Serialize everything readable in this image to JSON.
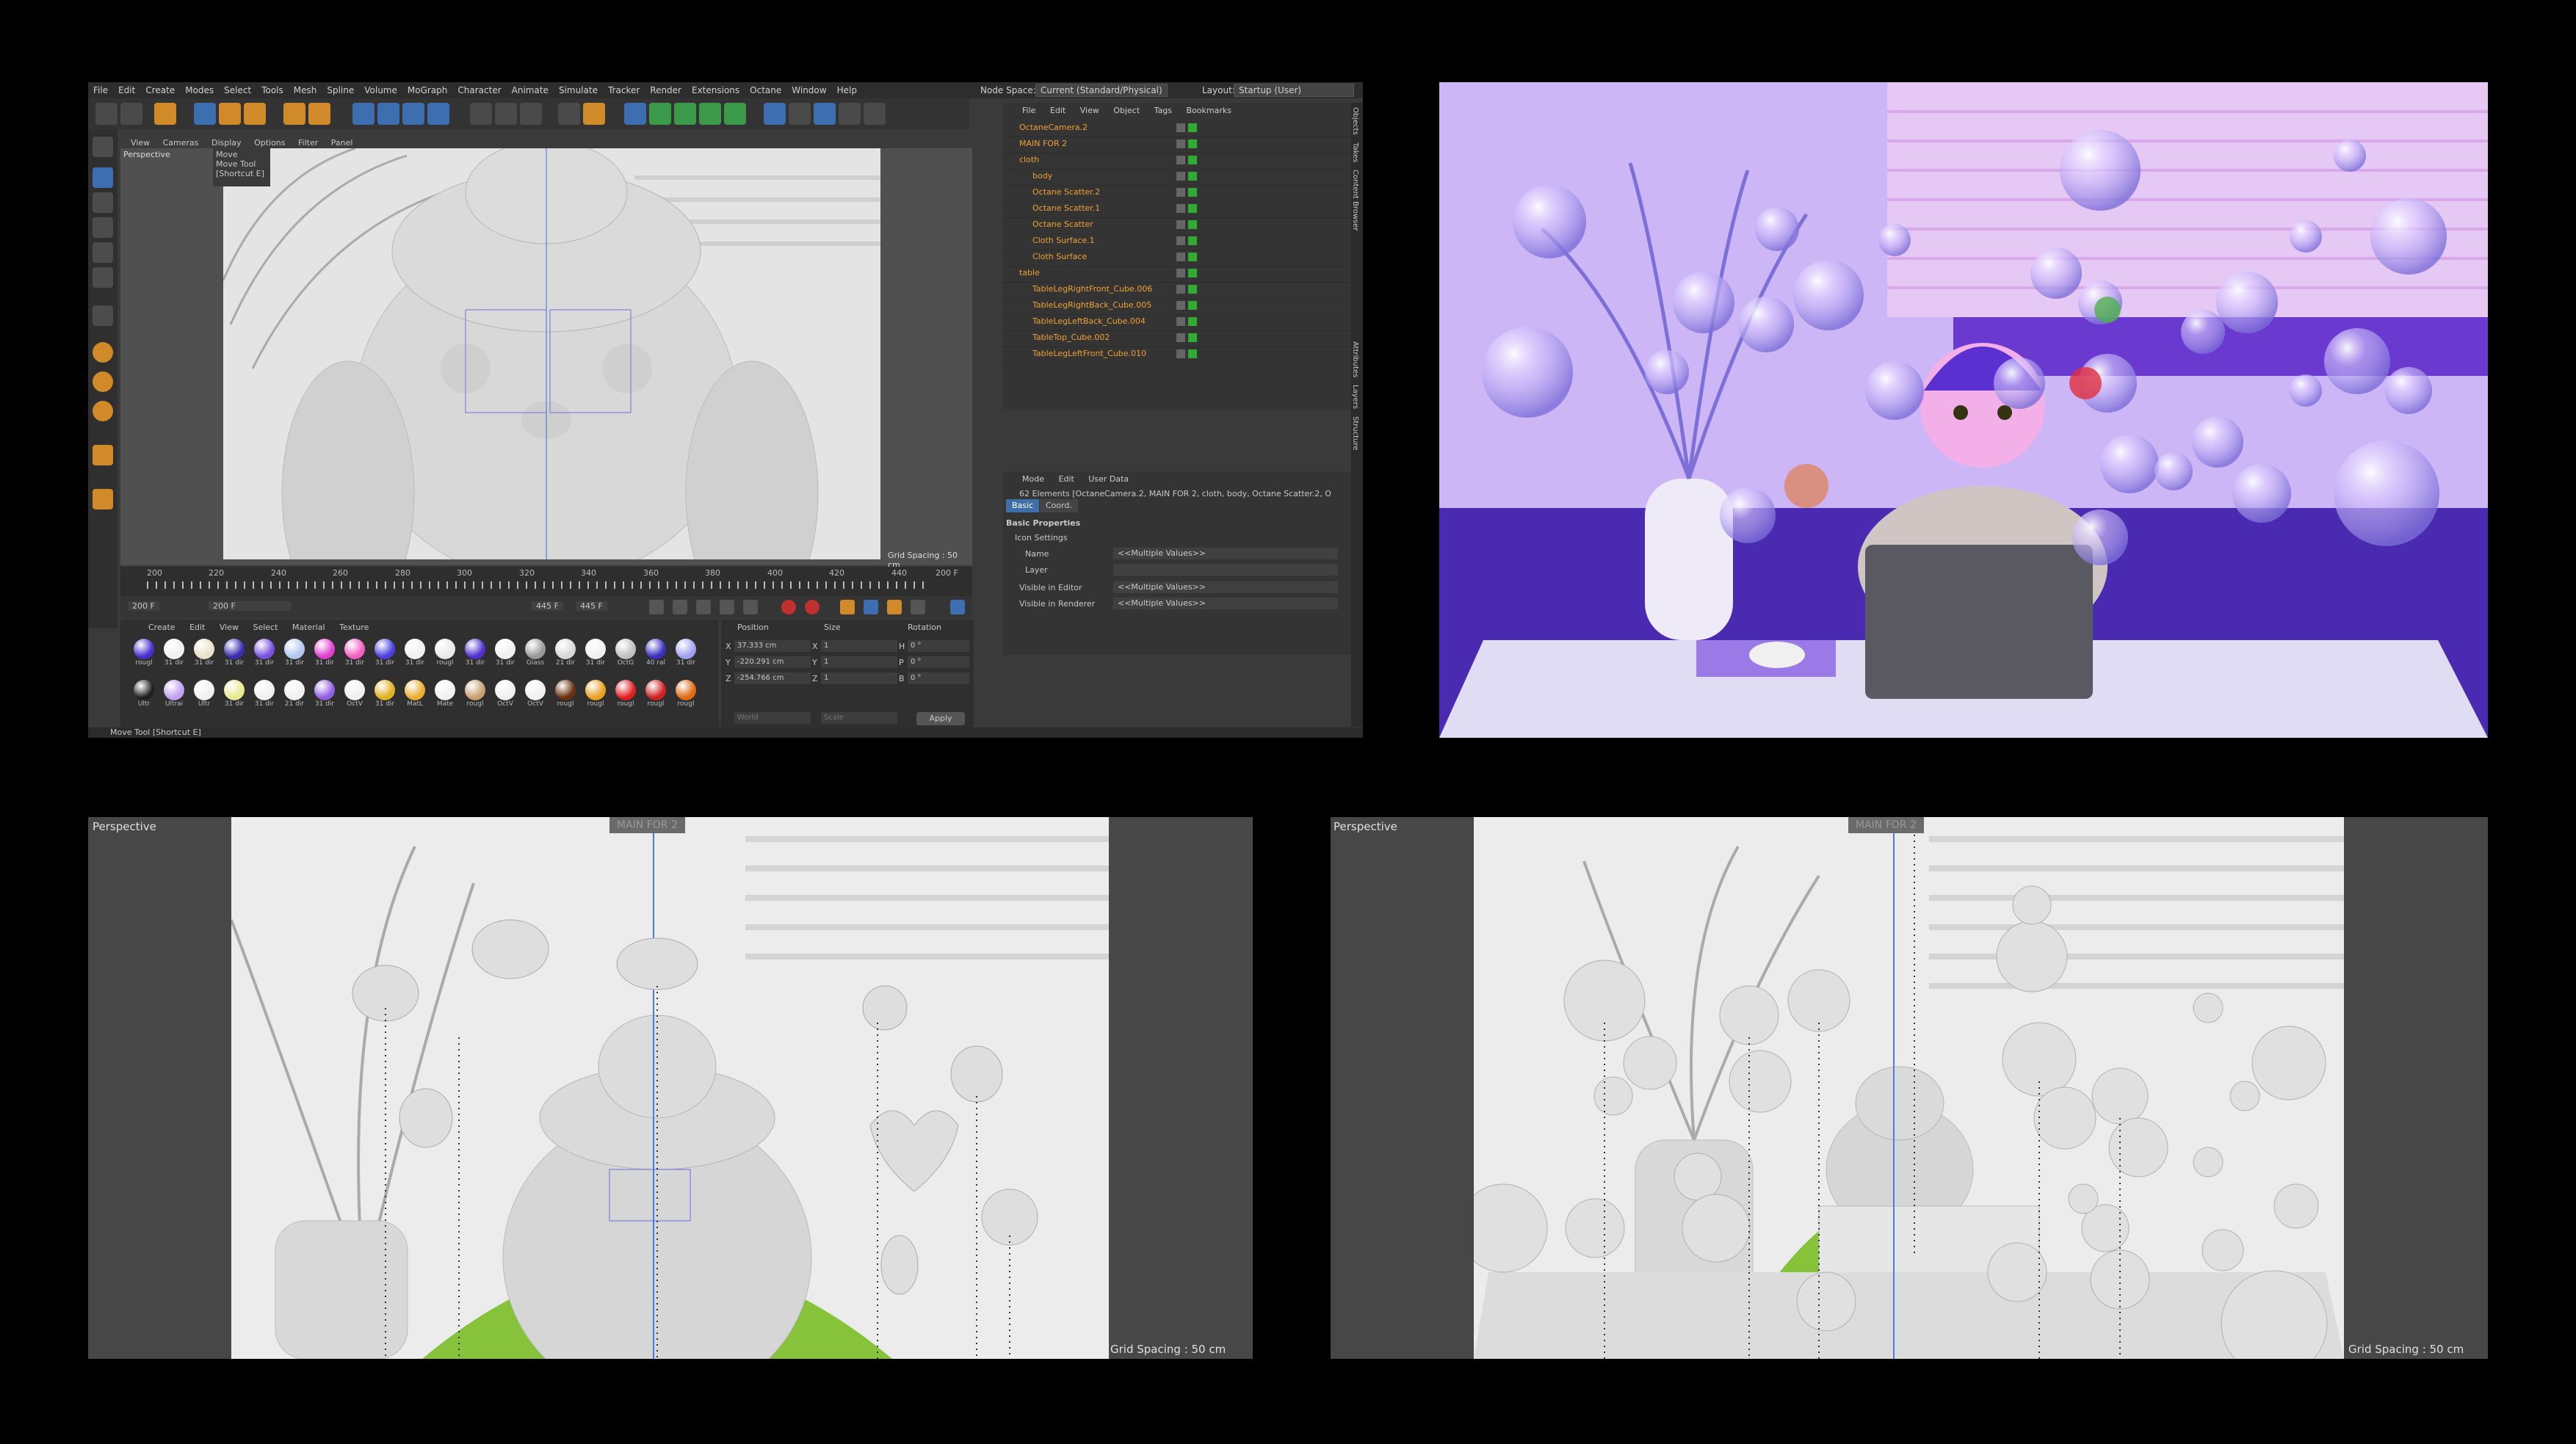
{
  "app": {
    "menu": [
      "File",
      "Edit",
      "Create",
      "Modes",
      "Select",
      "Tools",
      "Mesh",
      "Spline",
      "Volume",
      "MoGraph",
      "Character",
      "Animate",
      "Simulate",
      "Tracker",
      "Render",
      "Extensions",
      "Octane",
      "Window",
      "Help"
    ],
    "node_space_label": "Node Space:",
    "node_space_value": "Current (Standard/Physical)",
    "layout_label": "Layout:",
    "layout_value": "Startup (User)"
  },
  "viewport": {
    "menu": [
      "View",
      "Cameras",
      "Display",
      "Options",
      "Filter",
      "Panel"
    ],
    "label": "Perspective",
    "tooltip_title": "Move",
    "tooltip_line1": "Move Tool",
    "tooltip_line2": "[Shortcut E]",
    "grid_spacing": "Grid Spacing : 50 cm"
  },
  "timeline": {
    "ticks": [
      "200",
      "220",
      "240",
      "260",
      "280",
      "300",
      "320",
      "340",
      "360",
      "380",
      "400",
      "420",
      "440"
    ],
    "end_label": "200 F",
    "start_field": "200 F",
    "current_field": "200 F",
    "end_field": "445 F",
    "max_field": "445 F"
  },
  "materials": {
    "menu": [
      "Create",
      "Edit",
      "View",
      "Select",
      "Material",
      "Texture"
    ],
    "row1": [
      {
        "name": "rougl",
        "color": "#4a2fd0"
      },
      {
        "name": "31 dir",
        "color": "#f0f0f0"
      },
      {
        "name": "31 dir",
        "color": "#e8e0c8"
      },
      {
        "name": "31 dir",
        "color": "#3a2fb0"
      },
      {
        "name": "31 dir",
        "color": "#7a50e0"
      },
      {
        "name": "31 dir",
        "color": "#b0c8f0"
      },
      {
        "name": "31 dir",
        "color": "#e040d0"
      },
      {
        "name": "31 dir",
        "color": "#f060c0"
      },
      {
        "name": "31 dir",
        "color": "#4a40e0"
      },
      {
        "name": "31 dir",
        "color": "#f0f0f0"
      },
      {
        "name": "rougl",
        "color": "#e8e8e8"
      },
      {
        "name": "31 dir",
        "color": "#5030d0"
      },
      {
        "name": "31 dir",
        "color": "#f0f0f0"
      },
      {
        "name": "Glass",
        "color": "#999999"
      },
      {
        "name": "21 dir",
        "color": "#d8d8d8"
      },
      {
        "name": "31 dir",
        "color": "#f0f0f0"
      },
      {
        "name": "OctG",
        "color": "#c0c0c0"
      },
      {
        "name": "40 ral",
        "color": "#3a30c0"
      },
      {
        "name": "31 dir",
        "color": "#a0a0f0"
      }
    ],
    "row2": [
      {
        "name": "Ultr",
        "color": "#202020"
      },
      {
        "name": "Ultrai",
        "color": "#c0a0f0"
      },
      {
        "name": "Ultr",
        "color": "#f0f0f0"
      },
      {
        "name": "31 dir",
        "color": "#e8e890"
      },
      {
        "name": "31 dir",
        "color": "#f0f0f0"
      },
      {
        "name": "21 dir",
        "color": "#f0f0f0"
      },
      {
        "name": "31 dir",
        "color": "#9060e0"
      },
      {
        "name": "OctV",
        "color": "#f0f0f0"
      },
      {
        "name": "31 dir",
        "color": "#e0b020"
      },
      {
        "name": "MatL",
        "color": "#e8b030"
      },
      {
        "name": "Mate",
        "color": "#f0f0f0"
      },
      {
        "name": "rougl",
        "color": "#c8a070"
      },
      {
        "name": "OctV",
        "color": "#f0f0f0"
      },
      {
        "name": "OctV",
        "color": "#f0f0f0"
      },
      {
        "name": "rougl",
        "color": "#6a3010"
      },
      {
        "name": "rougl",
        "color": "#e8a020"
      },
      {
        "name": "rougl",
        "color": "#e02020"
      },
      {
        "name": "rougl",
        "color": "#d02020"
      },
      {
        "name": "rougl",
        "color": "#e06a10"
      }
    ]
  },
  "coords": {
    "headers": [
      "Position",
      "Size",
      "Rotation"
    ],
    "rows": [
      {
        "axis": "X",
        "pos": "37.333 cm",
        "size_axis": "X",
        "size": "1",
        "rot_axis": "H",
        "rot": "0 °"
      },
      {
        "axis": "Y",
        "pos": "-220.291 cm",
        "size_axis": "Y",
        "size": "1",
        "rot_axis": "P",
        "rot": "0 °"
      },
      {
        "axis": "Z",
        "pos": "-254.766 cm",
        "size_axis": "Z",
        "size": "1",
        "rot_axis": "B",
        "rot": "0 °"
      }
    ],
    "mode1": "World",
    "mode2": "Scale",
    "apply": "Apply"
  },
  "status": "Move Tool [Shortcut E]",
  "objects": {
    "menu": [
      "File",
      "Edit",
      "View",
      "Object",
      "Tags",
      "Bookmarks"
    ],
    "items": [
      {
        "name": "OctaneCamera.2",
        "color": "orange",
        "indent": 0
      },
      {
        "name": "MAIN FOR 2",
        "color": "orange",
        "indent": 0
      },
      {
        "name": "cloth",
        "color": "orange",
        "indent": 0
      },
      {
        "name": "body",
        "color": "orange",
        "indent": 1
      },
      {
        "name": "Octane Scatter.2",
        "color": "orange",
        "indent": 1
      },
      {
        "name": "Octane Scatter.1",
        "color": "orange",
        "indent": 1
      },
      {
        "name": "Octane Scatter",
        "color": "orange",
        "indent": 1
      },
      {
        "name": "Cloth Surface.1",
        "color": "orange",
        "indent": 1
      },
      {
        "name": "Cloth Surface",
        "color": "orange",
        "indent": 1
      },
      {
        "name": "table",
        "color": "orange",
        "indent": 0
      },
      {
        "name": "TableLegRightFront_Cube.006",
        "color": "orange",
        "indent": 1
      },
      {
        "name": "TableLegRightBack_Cube.005",
        "color": "orange",
        "indent": 1
      },
      {
        "name": "TableLegLeftBack_Cube.004",
        "color": "orange",
        "indent": 1
      },
      {
        "name": "TableTop_Cube.002",
        "color": "orange",
        "indent": 1
      },
      {
        "name": "TableLegLeftFront_Cube.010",
        "color": "orange",
        "indent": 1
      }
    ]
  },
  "attributes": {
    "menu": [
      "Mode",
      "Edit",
      "User Data"
    ],
    "summary": "62 Elements [OctaneCamera.2, MAIN FOR 2, cloth, body, Octane Scatter.2, O",
    "tabs": [
      "Basic",
      "Coord."
    ],
    "section": "Basic Properties",
    "sub": "Icon Settings",
    "name_label": "Name",
    "name_value": "<<Multiple Values>>",
    "layer_label": "Layer",
    "vis_editor_label": "Visible in Editor",
    "vis_editor_value": "<<Multiple Values>>",
    "vis_render_label": "Visible in Renderer",
    "vis_render_value": "<<Multiple Values>>"
  },
  "side_tabs": [
    "Objects",
    "Takes",
    "Content Browser",
    "Attributes",
    "Layers",
    "Structure"
  ],
  "bottom_left": {
    "label": "Perspective",
    "camera_tag": "MAIN FOR 2",
    "grid_spacing": "Grid Spacing : 50 cm"
  },
  "bottom_right": {
    "label": "Perspective",
    "camera_tag": "MAIN FOR 2",
    "grid_spacing": "Grid Spacing : 50 cm"
  },
  "colors": {
    "orange_accent": "#d08a2a",
    "blue_accent": "#3d6fb0",
    "grass_green": "#86c23a",
    "render_purple": "#cbb3f2"
  }
}
